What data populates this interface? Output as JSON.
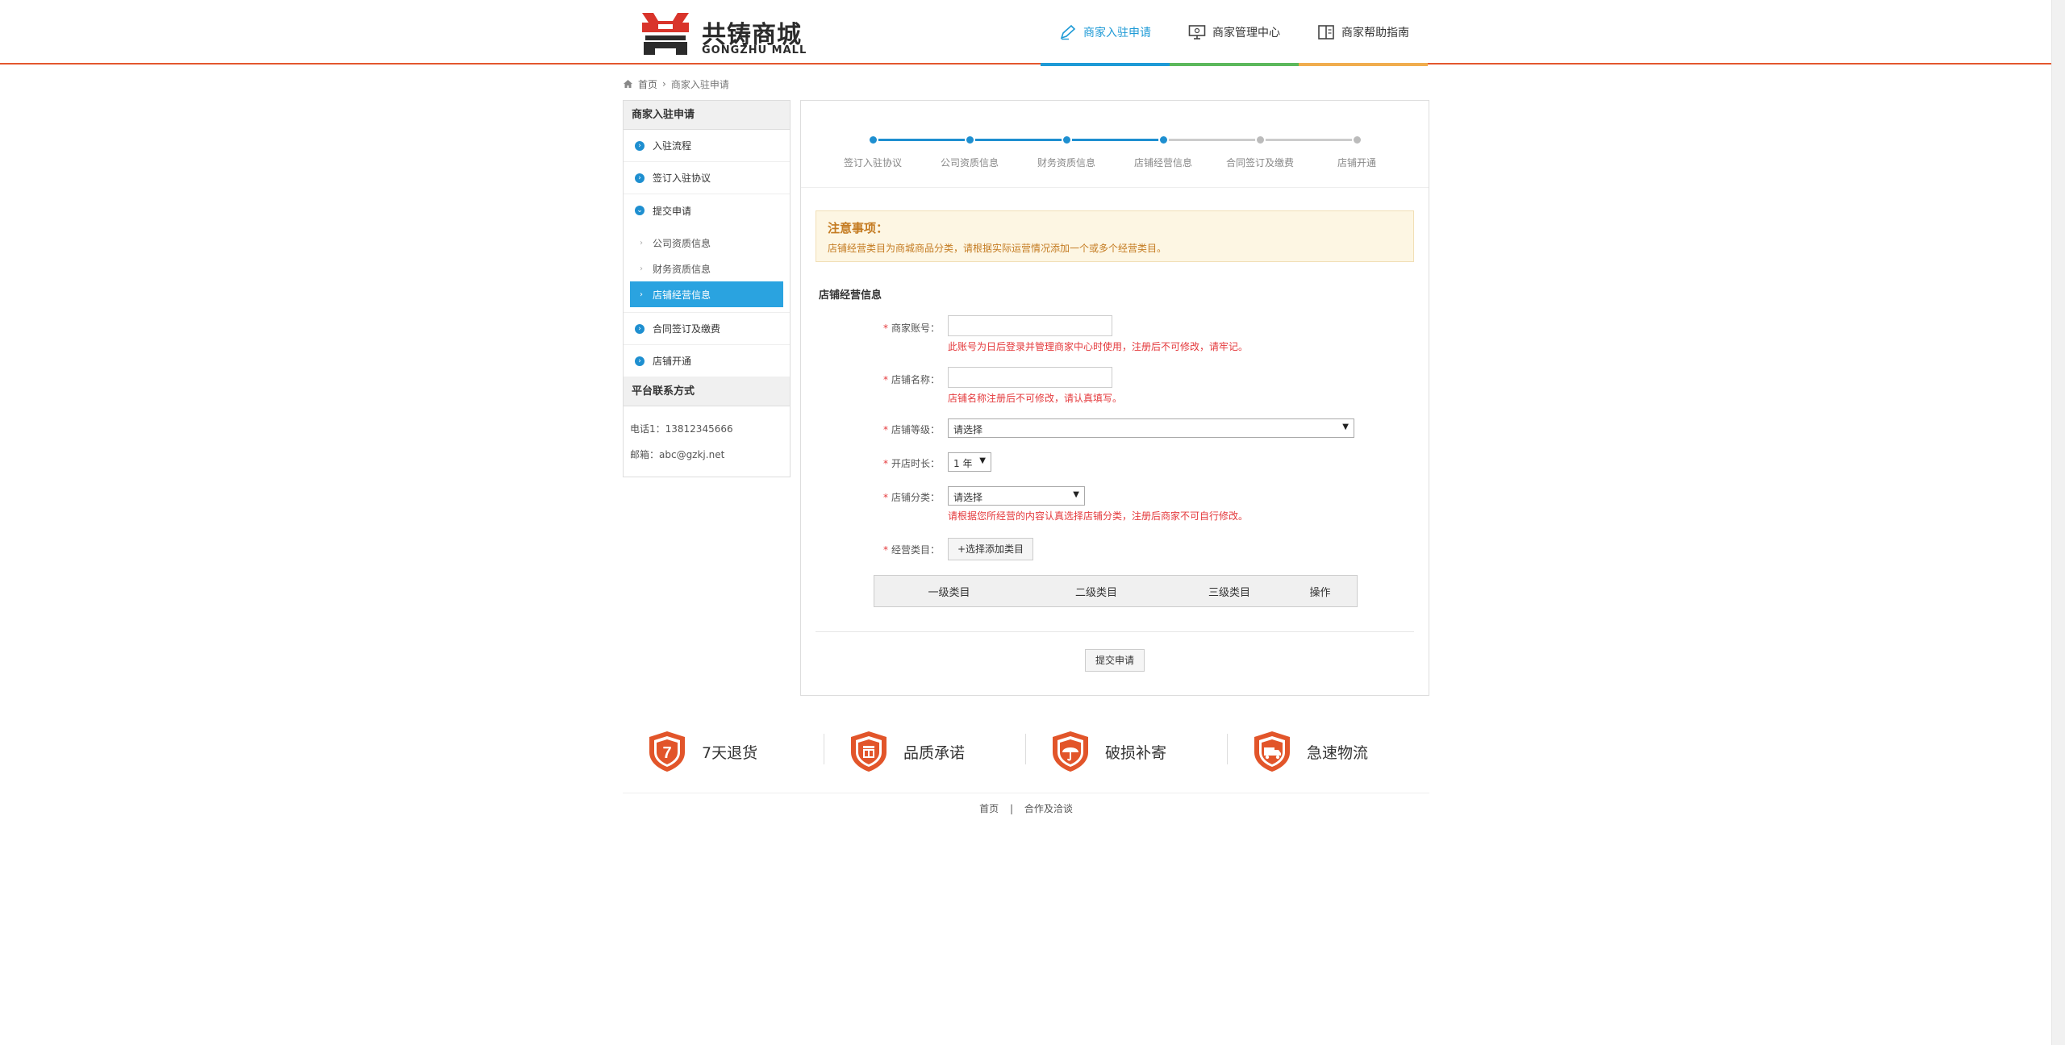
{
  "header": {
    "logo_name": "共铸商城",
    "logo_sub": "GONGZHU MALL",
    "nav": [
      {
        "label": "商家入驻申请",
        "icon": "pen-icon",
        "active": true,
        "bar_color": "#1e9ad6"
      },
      {
        "label": "商家管理中心",
        "icon": "monitor-icon",
        "active": false,
        "bar_color": "#5cb85c"
      },
      {
        "label": "商家帮助指南",
        "icon": "book-icon",
        "active": false,
        "bar_color": "#f0ad4e"
      }
    ]
  },
  "breadcrumb": {
    "home": "首页",
    "sep": "›",
    "current": "商家入驻申请"
  },
  "sidebar": {
    "title": "商家入驻申请",
    "items": [
      {
        "label": "入驻流程"
      },
      {
        "label": "签订入驻协议"
      },
      {
        "label": "提交申请"
      }
    ],
    "sub_items": [
      {
        "label": "公司资质信息"
      },
      {
        "label": "财务资质信息"
      },
      {
        "label": "店铺经营信息"
      }
    ],
    "items_after": [
      {
        "label": "合同签订及缴费"
      },
      {
        "label": "店铺开通"
      }
    ],
    "contact_title": "平台联系方式",
    "phone": "电话1：13812345666",
    "email": "邮箱：abc@gzkj.net"
  },
  "steps": [
    {
      "label": "签订入驻协议",
      "done": true
    },
    {
      "label": "公司资质信息",
      "done": true
    },
    {
      "label": "财务资质信息",
      "done": true
    },
    {
      "label": "店铺经营信息",
      "done": true
    },
    {
      "label": "合同签订及缴费",
      "done": false
    },
    {
      "label": "店铺开通",
      "done": false
    }
  ],
  "notice": {
    "title": "注意事项：",
    "text": "店铺经营类目为商城商品分类，请根据实际运营情况添加一个或多个经营类目。"
  },
  "form": {
    "section_title": "店铺经营信息",
    "required_mark": "*",
    "account_label": "商家账号：",
    "account_value": "",
    "account_hint": "此账号为日后登录并管理商家中心时使用，注册后不可修改，请牢记。",
    "shopname_label": "店铺名称：",
    "shopname_value": "",
    "shopname_hint": "店铺名称注册后不可修改，请认真填写。",
    "level_label": "店铺等级：",
    "level_value": "请选择",
    "duration_label": "开店时长：",
    "duration_value": "1 年",
    "category_label": "店铺分类：",
    "category_value": "请选择",
    "category_hint": "请根据您所经营的内容认真选择店铺分类，注册后商家不可自行修改。",
    "biz_label": "经营类目：",
    "add_button": "+选择添加类目",
    "table_headers": [
      "一级类目",
      "二级类目",
      "三级类目",
      "操作"
    ],
    "submit": "提交申请"
  },
  "guarantees": [
    {
      "label": "7天退货",
      "icon": "return-7-day-icon"
    },
    {
      "label": "品质承诺",
      "icon": "quality-icon"
    },
    {
      "label": "破损补寄",
      "icon": "umbrella-icon"
    },
    {
      "label": "急速物流",
      "icon": "delivery-truck-icon"
    }
  ],
  "footer": {
    "links": [
      "首页",
      "合作及洽谈"
    ],
    "sep": "|"
  },
  "colors": {
    "accent": "#e4572e",
    "blue": "#1e9ad6",
    "sidebar_active": "#2aa3e0",
    "error": "#e4393c"
  }
}
